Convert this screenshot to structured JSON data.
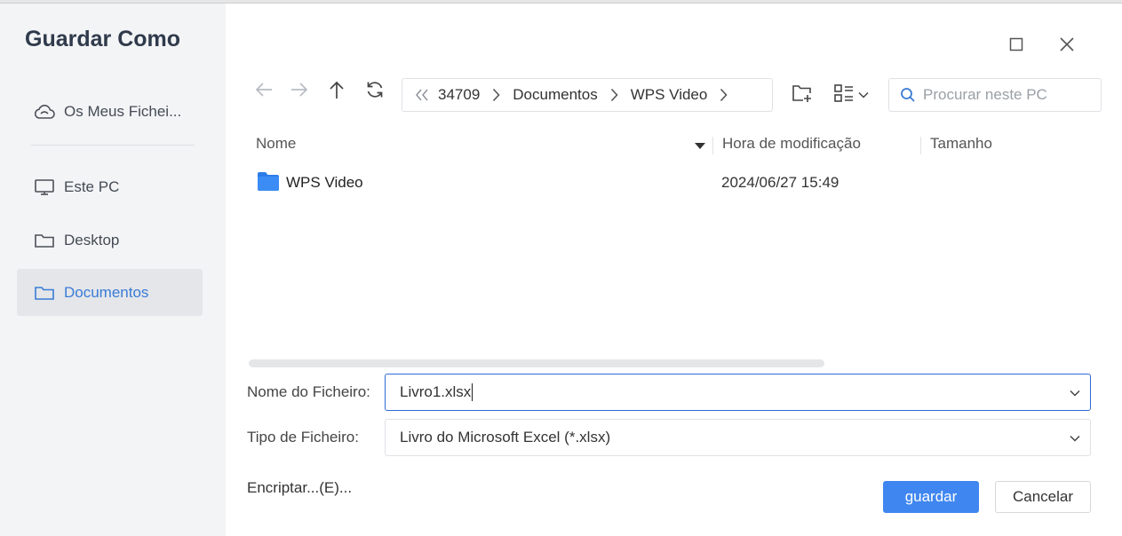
{
  "dialog": {
    "title": "Guardar Como"
  },
  "sidebar": {
    "items": [
      {
        "label": "Os Meus Fichei...",
        "icon": "cloud-icon"
      },
      {
        "label": "Este PC",
        "icon": "monitor-icon"
      },
      {
        "label": "Desktop",
        "icon": "folder-icon"
      },
      {
        "label": "Documentos",
        "icon": "folder-icon",
        "active": true
      }
    ]
  },
  "breadcrumb": {
    "items": [
      "34709",
      "Documentos",
      "WPS Video"
    ]
  },
  "search": {
    "placeholder": "Procurar neste PC"
  },
  "columns": {
    "name": "Nome",
    "modified": "Hora de modificação",
    "size": "Tamanho"
  },
  "files": [
    {
      "name": "WPS Video",
      "modified": "2024/06/27 15:49",
      "size": "",
      "type": "folder"
    }
  ],
  "form": {
    "filename_label": "Nome do Ficheiro:",
    "filename_value": "Livro1.xlsx",
    "filetype_label": "Tipo de Ficheiro:",
    "filetype_value": "Livro do Microsoft Excel (*.xlsx)"
  },
  "actions": {
    "encrypt": "Encriptar...(E)...",
    "save": "guardar",
    "cancel": "Cancelar"
  },
  "colors": {
    "accent": "#3f86f0",
    "active_text": "#3a7bd5",
    "folder": "#2b7de9"
  }
}
